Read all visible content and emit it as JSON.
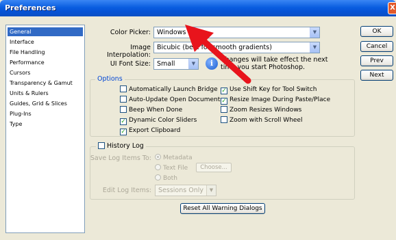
{
  "window": {
    "title": "Preferences",
    "close": "X"
  },
  "sidebar": {
    "items": [
      {
        "label": "General",
        "selected": true
      },
      {
        "label": "Interface"
      },
      {
        "label": "File Handling"
      },
      {
        "label": "Performance"
      },
      {
        "label": "Cursors"
      },
      {
        "label": "Transparency & Gamut"
      },
      {
        "label": "Units & Rulers"
      },
      {
        "label": "Guides, Grid & Slices"
      },
      {
        "label": "Plug-Ins"
      },
      {
        "label": "Type"
      }
    ]
  },
  "buttons": {
    "ok": "OK",
    "cancel": "Cancel",
    "prev": "Prev",
    "next": "Next",
    "reset": "Reset All Warning Dialogs"
  },
  "fields": {
    "color_picker": {
      "label": "Color Picker:",
      "value": "Windows"
    },
    "image_interpolation": {
      "label": "Image Interpolation:",
      "value": "Bicubic (best for smooth gradients)"
    },
    "ui_font_size": {
      "label": "UI Font Size:",
      "value": "Small"
    }
  },
  "note": {
    "line1": "Changes will take effect the next",
    "line2": "time you start Photoshop."
  },
  "options": {
    "title": "Options",
    "left": [
      {
        "label": "Automatically Launch Bridge",
        "checked": false
      },
      {
        "label": "Auto-Update Open Documents",
        "checked": false
      },
      {
        "label": "Beep When Done",
        "checked": false
      },
      {
        "label": "Dynamic Color Sliders",
        "checked": true
      },
      {
        "label": "Export Clipboard",
        "checked": true
      }
    ],
    "right": [
      {
        "label": "Use Shift Key for Tool Switch",
        "checked": true
      },
      {
        "label": "Resize Image During Paste/Place",
        "checked": true
      },
      {
        "label": "Zoom Resizes Windows",
        "checked": false
      },
      {
        "label": "Zoom with Scroll Wheel",
        "checked": false
      }
    ]
  },
  "history": {
    "title": "History Log",
    "save_label": "Save Log Items To:",
    "radios": [
      "Metadata",
      "Text File",
      "Both"
    ],
    "choose": "Choose...",
    "edit_label": "Edit Log Items:",
    "edit_value": "Sessions Only"
  },
  "colors": {
    "accent": "#316ac5",
    "titlebar": "#0a5ee0",
    "annotation_arrow": "#e8141c"
  }
}
